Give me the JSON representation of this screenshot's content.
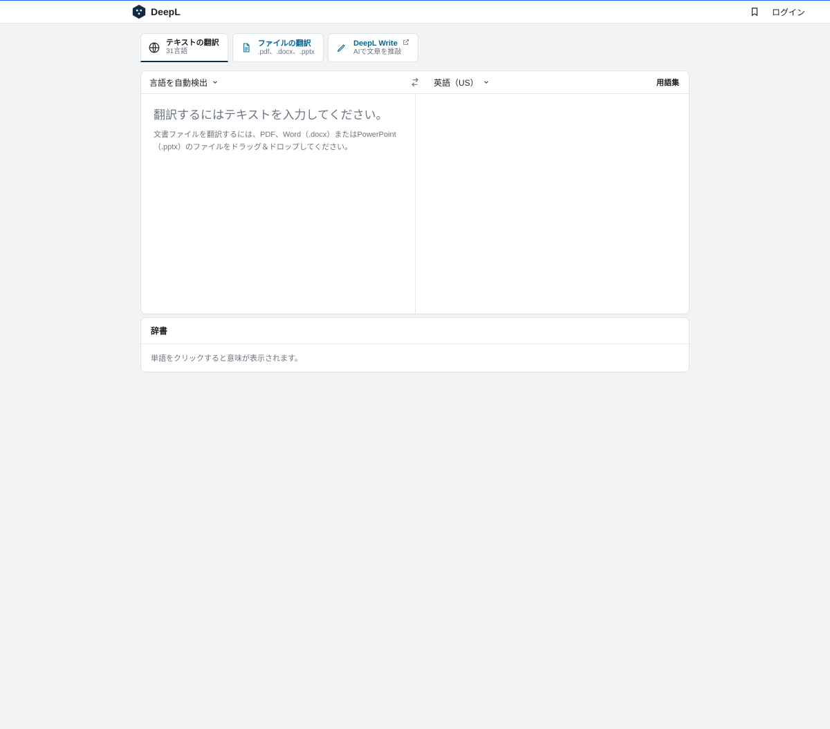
{
  "header": {
    "brand": "DeepL",
    "login": "ログイン"
  },
  "tabs": [
    {
      "title": "テキストの翻訳",
      "sub": "31言語"
    },
    {
      "title": "ファイルの翻訳",
      "sub": ".pdf、.docx、.pptx"
    },
    {
      "title": "DeepL Write",
      "sub": "AIで文章を推敲"
    }
  ],
  "lang": {
    "source": "言語を自動検出",
    "target": "英語（US）",
    "glossary": "用語集"
  },
  "source": {
    "placeholder_title": "翻訳するにはテキストを入力してください。",
    "placeholder_hint": "文書ファイルを翻訳するには、PDF、Word（.docx）またはPowerPoint（.pptx）のファイルをドラッグ＆ドロップしてください。"
  },
  "dictionary": {
    "title": "辞書",
    "hint": "単語をクリックすると意味が表示されます。"
  }
}
